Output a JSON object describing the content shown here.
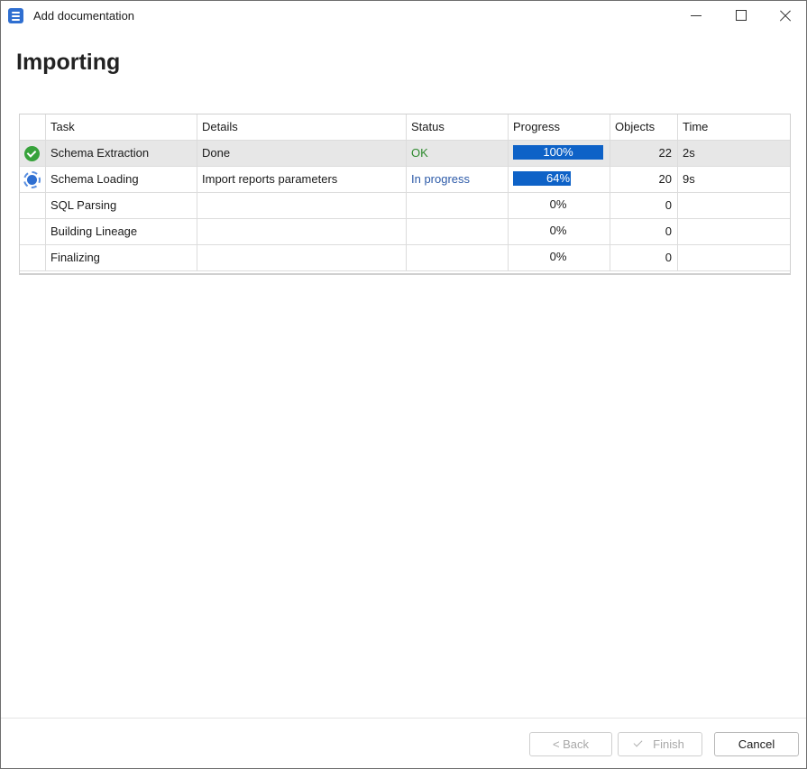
{
  "window": {
    "title": "Add documentation",
    "heading": "Importing"
  },
  "columns": [
    "",
    "Task",
    "Details",
    "Status",
    "Progress",
    "Objects",
    "Time"
  ],
  "rows": [
    {
      "icon": "ok-check-icon",
      "task": "Schema Extraction",
      "details": "Done",
      "status": "OK",
      "status_color": "#2f8a2f",
      "progress_label": "100%",
      "progress_value": 1.0,
      "objects": "22",
      "time": "2s"
    },
    {
      "icon": "in-progress-icon",
      "task": "Schema Loading",
      "details": "Import reports parameters",
      "status": "In progress",
      "status_color": "#2c5aa8",
      "progress_label": "64%",
      "progress_value": 0.64,
      "objects": "20",
      "time": "9s"
    },
    {
      "icon": "",
      "task": "SQL Parsing",
      "details": "",
      "status": "",
      "progress_label": "0%",
      "progress_value": 0,
      "objects": "0",
      "time": ""
    },
    {
      "icon": "",
      "task": "Building Lineage",
      "details": "",
      "status": "",
      "progress_label": "0%",
      "progress_value": 0,
      "objects": "0",
      "time": ""
    },
    {
      "icon": "",
      "task": "Finalizing",
      "details": "",
      "status": "",
      "progress_label": "0%",
      "progress_value": 0,
      "objects": "0",
      "time": ""
    }
  ],
  "buttons": {
    "back": "< Back",
    "finish": "Finish",
    "cancel": "Cancel"
  },
  "colors": {
    "accent": "#2f6fd1",
    "progress_fill": "#0e62c7",
    "selected_row": "#e7e7e7"
  }
}
